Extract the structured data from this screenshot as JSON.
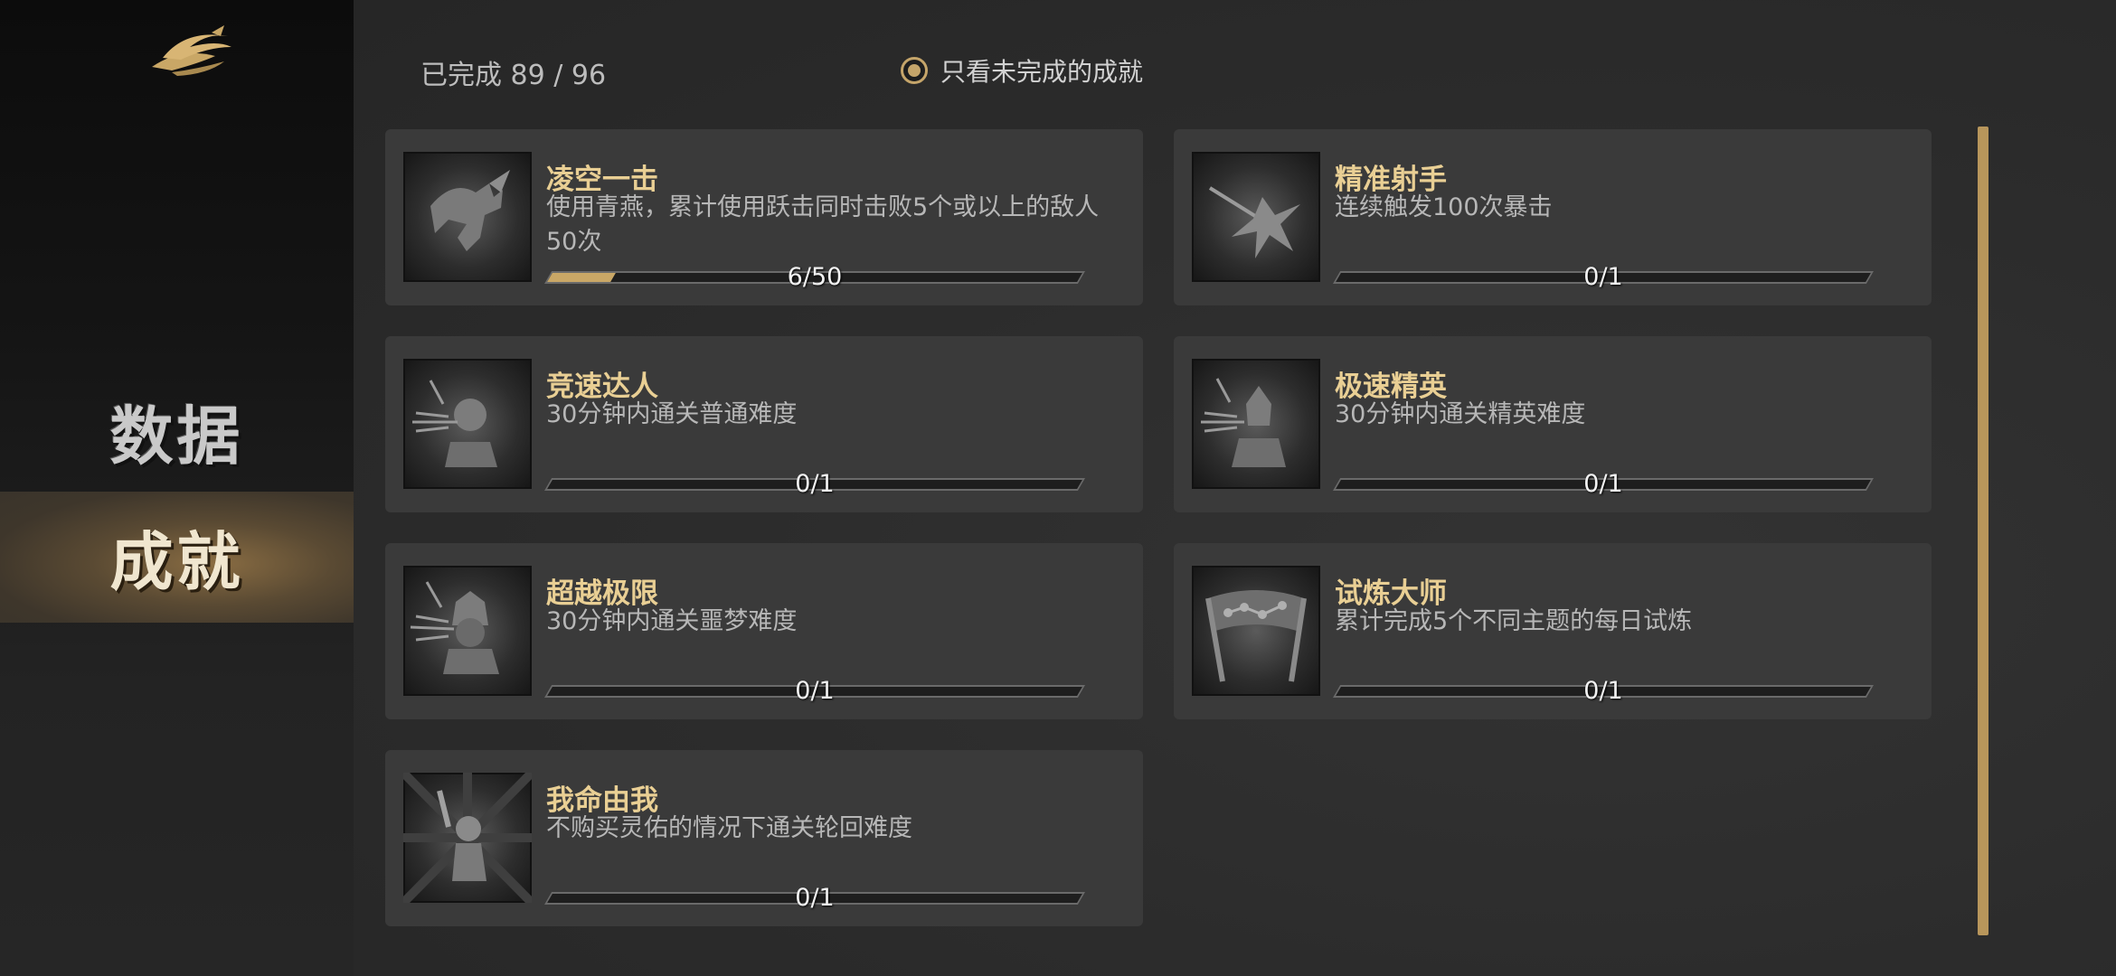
{
  "sidebar": {
    "logo_icon": "swallow-logo-icon",
    "nav": [
      {
        "label": "数据",
        "active": false
      },
      {
        "label": "成就",
        "active": true
      }
    ]
  },
  "header": {
    "completed_label": "已完成 89 / 96",
    "filter_label": "只看未完成的成就",
    "filter_checked": true
  },
  "colors": {
    "accent": "#c9a766",
    "title": "#e9cf94",
    "card_bg": "#3a3a3a"
  },
  "achievements": [
    {
      "title": "凌空一击",
      "desc": "使用青燕，累计使用跃击同时击败5个或以上的敌人50次",
      "progress": "6/50",
      "fraction": 0.12,
      "icon": "leaping-strike-icon"
    },
    {
      "title": "精准射手",
      "desc": "连续触发100次暴击",
      "progress": "0/1",
      "fraction": 0,
      "icon": "critical-hit-icon"
    },
    {
      "title": "竞速达人",
      "desc": "30分钟内通关普通难度",
      "progress": "0/1",
      "fraction": 0,
      "icon": "speed-warrior-icon"
    },
    {
      "title": "极速精英",
      "desc": "30分钟内通关精英难度",
      "progress": "0/1",
      "fraction": 0,
      "icon": "speed-elite-icon"
    },
    {
      "title": "超越极限",
      "desc": "30分钟内通关噩梦难度",
      "progress": "0/1",
      "fraction": 0,
      "icon": "beyond-limit-icon"
    },
    {
      "title": "试炼大师",
      "desc": "累计完成5个不同主题的每日试炼",
      "progress": "0/1",
      "fraction": 0,
      "icon": "trial-banner-icon"
    },
    {
      "title": "我命由我",
      "desc": "不购买灵佑的情况下通关轮回难度",
      "progress": "0/1",
      "fraction": 0,
      "icon": "own-fate-icon"
    }
  ]
}
